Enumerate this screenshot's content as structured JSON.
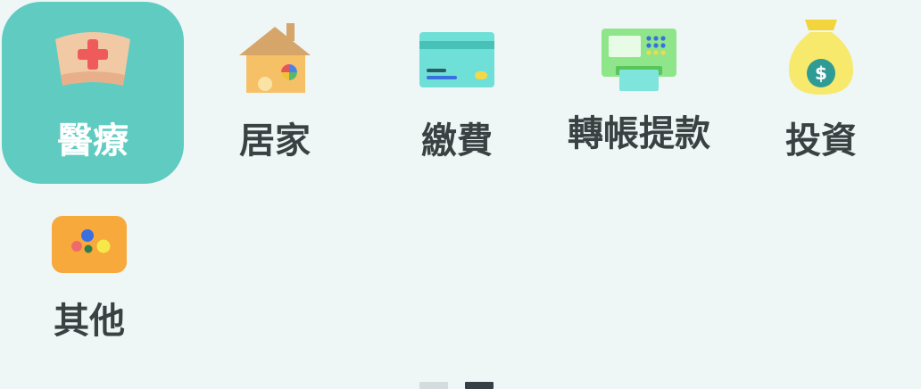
{
  "categories": [
    {
      "label": "醫療",
      "icon": "nurse-cap-icon",
      "active": true
    },
    {
      "label": "居家",
      "icon": "house-icon",
      "active": false
    },
    {
      "label": "繳費",
      "icon": "credit-card-icon",
      "active": false
    },
    {
      "label": "轉帳提款",
      "icon": "atm-icon",
      "active": false
    },
    {
      "label": "投資",
      "icon": "money-bag-icon",
      "active": false
    },
    {
      "label": "其他",
      "icon": "more-dots-icon",
      "active": false
    }
  ],
  "pager": {
    "pages": 2,
    "current_page": 2
  },
  "colors": {
    "background": "#eef6f6",
    "active_tile": "#5fcbc1",
    "label_text": "#3a4143",
    "active_label_text": "#ffffff"
  }
}
